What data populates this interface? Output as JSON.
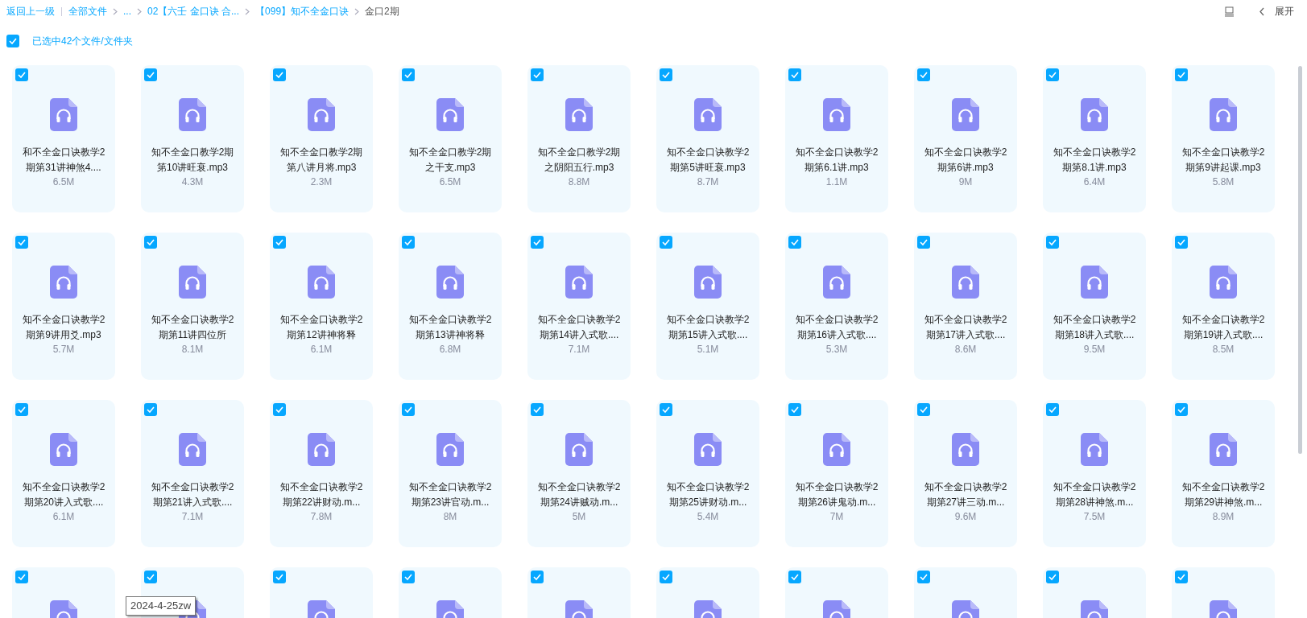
{
  "breadcrumb": {
    "back": "返回上一级",
    "path": [
      {
        "label": "全部文件",
        "current": false
      },
      {
        "label": "...",
        "current": false
      },
      {
        "label": "02【六壬 金口诀 合...",
        "current": false
      },
      {
        "label": "【099】知不全金口诀",
        "current": false
      },
      {
        "label": "金口2期",
        "current": true
      }
    ]
  },
  "toolbar": {
    "expand": "展开"
  },
  "selection": {
    "checked": true,
    "label": "已选中42个文件/文件夹"
  },
  "files": [
    {
      "name": "和不全金口诀教学2期第31讲神煞4....",
      "size": "6.5M",
      "selected": true
    },
    {
      "name": "知不全金口教学2期第10讲旺衰.mp3",
      "size": "4.3M",
      "selected": true
    },
    {
      "name": "知不全金口教学2期第八讲月将.mp3",
      "size": "2.3M",
      "selected": true
    },
    {
      "name": "知不全金口教学2期之干支.mp3",
      "size": "6.5M",
      "selected": true
    },
    {
      "name": "知不全金口教学2期之阴阳五行.mp3",
      "size": "8.8M",
      "selected": true
    },
    {
      "name": "知不全金口诀教学2期第5讲旺衰.mp3",
      "size": "8.7M",
      "selected": true
    },
    {
      "name": "知不全金口诀教学2期第6.1讲.mp3",
      "size": "1.1M",
      "selected": true
    },
    {
      "name": "知不全金口诀教学2期第6讲.mp3",
      "size": "9M",
      "selected": true
    },
    {
      "name": "知不全金口诀教学2期第8.1讲.mp3",
      "size": "6.4M",
      "selected": true
    },
    {
      "name": "知不全金口诀教学2期第9讲起课.mp3",
      "size": "5.8M",
      "selected": true
    },
    {
      "name": "知不全金口诀教学2期第9讲用爻.mp3",
      "size": "5.7M",
      "selected": true
    },
    {
      "name": "知不全金口诀教学2期第11讲四位所",
      "size": "8.1M",
      "selected": true
    },
    {
      "name": "知不全金口诀教学2期第12讲神将释",
      "size": "6.1M",
      "selected": true
    },
    {
      "name": "知不全金口诀教学2期第13讲神将释",
      "size": "6.8M",
      "selected": true
    },
    {
      "name": "知不全金口诀教学2期第14讲入式歌....",
      "size": "7.1M",
      "selected": true
    },
    {
      "name": "知不全金口诀教学2期第15讲入式歌....",
      "size": "5.1M",
      "selected": true
    },
    {
      "name": "知不全金口诀教学2期第16讲入式歌....",
      "size": "5.3M",
      "selected": true
    },
    {
      "name": "知不全金口诀教学2期第17讲入式歌....",
      "size": "8.6M",
      "selected": true
    },
    {
      "name": "知不全金口诀教学2期第18讲入式歌....",
      "size": "9.5M",
      "selected": true
    },
    {
      "name": "知不全金口诀教学2期第19讲入式歌....",
      "size": "8.5M",
      "selected": true
    },
    {
      "name": "知不全金口诀教学2期第20讲入式歌....",
      "size": "6.1M",
      "selected": true
    },
    {
      "name": "知不全金口诀教学2期第21讲入式歌....",
      "size": "7.1M",
      "selected": true
    },
    {
      "name": "知不全金口诀教学2期第22讲财动.m...",
      "size": "7.8M",
      "selected": true
    },
    {
      "name": "知不全金口诀教学2期第23讲官动.m...",
      "size": "8M",
      "selected": true
    },
    {
      "name": "知不全金口诀教学2期第24讲贼动.m...",
      "size": "5M",
      "selected": true
    },
    {
      "name": "知不全金口诀教学2期第25讲财动.m...",
      "size": "5.4M",
      "selected": true
    },
    {
      "name": "知不全金口诀教学2期第26讲鬼动.m...",
      "size": "7M",
      "selected": true
    },
    {
      "name": "知不全金口诀教学2期第27讲三动.m...",
      "size": "9.6M",
      "selected": true
    },
    {
      "name": "知不全金口诀教学2期第28讲神煞.m...",
      "size": "7.5M",
      "selected": true
    },
    {
      "name": "知不全金口诀教学2期第29讲神煞.m...",
      "size": "8.9M",
      "selected": true
    },
    {
      "selected": true
    },
    {
      "selected": true
    },
    {
      "selected": true
    },
    {
      "selected": true
    },
    {
      "selected": true
    },
    {
      "selected": true
    },
    {
      "selected": true
    },
    {
      "selected": true
    },
    {
      "selected": true
    },
    {
      "selected": true
    }
  ],
  "tooltip": "2024-4-25zw"
}
